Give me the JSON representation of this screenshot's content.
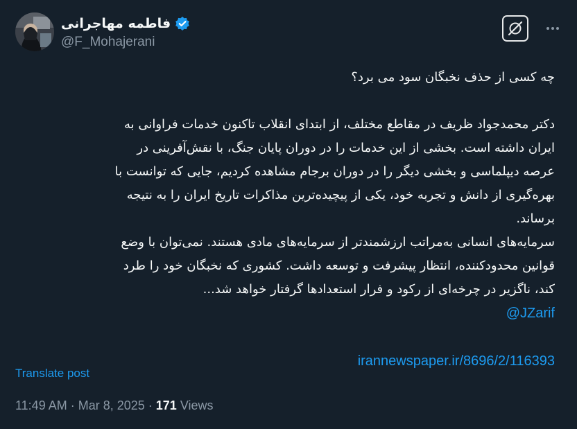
{
  "author": {
    "display_name": "فاطمه مهاجرانی",
    "handle": "@F_Mohajerani",
    "verified": true
  },
  "colors": {
    "background": "#15202b",
    "text": "#f7f9f9",
    "secondary": "#8b98a5",
    "accent": "#1d9bf0"
  },
  "icons": {
    "grok": "grok-icon",
    "more": "more-dots-icon",
    "verified": "verified-badge-icon"
  },
  "tweet": {
    "question": "چه کسی از حذف نخبگان سود می برد؟",
    "lines": [
      "دکتر محمدجواد ظریف در مقاطع مختلف، از ابتدای انقلاب تاکنون خدمات فراوانی به",
      "ایران داشته است. بخشی از این خدمات را در دوران پایان جنگ، با نقش‌آفرینی در",
      "عرصه دیپلماسی و بخشی دیگر را در دوران برجام مشاهده کردیم، جایی که توانست با",
      "بهره‌گیری از دانش و تجربه خود، یکی از پیچیده‌ترین مذاکرات تاریخ ایران را به نتیجه",
      "برساند.",
      "سرمایه‌های انسانی به‌مراتب ارزشمندتر از سرمایه‌های مادی هستند. نمی‌توان با وضع",
      "قوانین محدودکننده، انتظار پیشرفت و توسعه داشت. کشوری که نخبگان خود را طرد",
      "کند، ناگزیر در چرخه‌ای از رکود و فرار استعدادها گرفتار خواهد شد..."
    ],
    "mention": "@JZarif",
    "link": "irannewspaper.ir/8696/2/116393"
  },
  "translate_label": "Translate post",
  "meta": {
    "time": "11:49 AM",
    "separator": " · ",
    "date": "Mar 8, 2025",
    "views_count": "171",
    "views_label": " Views"
  }
}
